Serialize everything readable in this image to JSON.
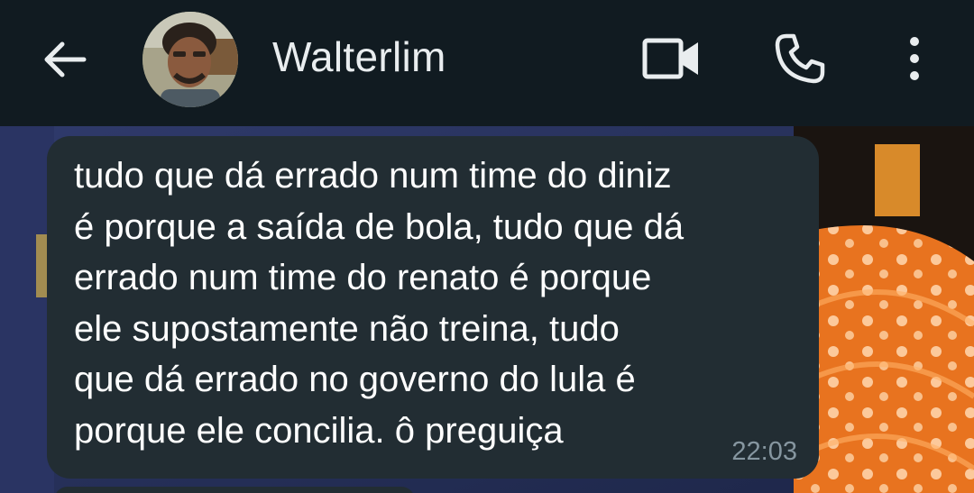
{
  "header": {
    "back_icon": "arrow-left-icon",
    "contact_name": "Walterlim",
    "video_icon": "video-call-icon",
    "call_icon": "phone-icon",
    "menu_icon": "more-vertical-icon"
  },
  "message": {
    "text": "tudo que dá errado num time do diniz\né porque a saída de bola, tudo que dá\nerrado num time do renato é porque\nele supostamente não treina, tudo\nque dá errado no governo do lula é\nporque ele concilia. ô preguiça",
    "time": "22:03"
  },
  "colors": {
    "appbar": "#111b21",
    "bubble": "#222d33",
    "text": "#ffffff",
    "timestamp": "#8696a0",
    "wallpaper_orange": "#e8731f"
  }
}
